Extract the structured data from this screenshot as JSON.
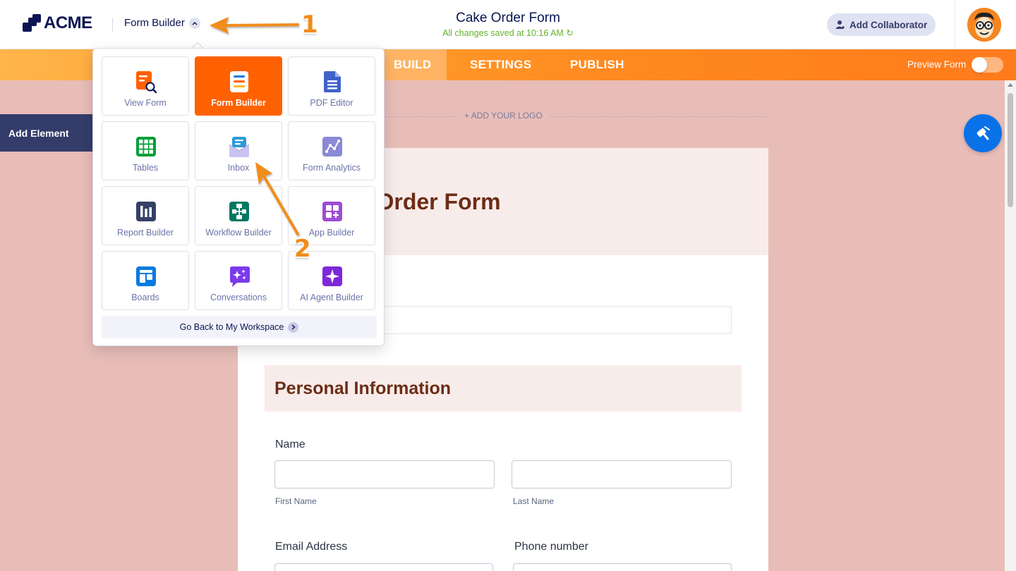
{
  "header": {
    "brand": "ACME",
    "product_switch_label": "Form Builder",
    "form_title": "Cake Order Form",
    "save_status": "All changes saved at 10:16 AM",
    "collaborator_button": "Add Collaborator"
  },
  "nav": {
    "tabs": [
      "BUILD",
      "SETTINGS",
      "PUBLISH"
    ],
    "active_tab": "BUILD",
    "preview_label": "Preview Form",
    "preview_enabled": false
  },
  "left_panel": {
    "add_element": "Add Element"
  },
  "form": {
    "add_logo": "+ ADD YOUR LOGO",
    "hero_title_visible": "ke Order Form",
    "section_title": "Personal Information",
    "fields": {
      "name_label": "Name",
      "first_name": "First Name",
      "last_name": "Last Name",
      "email_label": "Email Address",
      "phone_label": "Phone number"
    }
  },
  "dropdown": {
    "items": [
      {
        "label": "View Form",
        "icon": "view-form-icon",
        "color": "#ff6100"
      },
      {
        "label": "Form Builder",
        "icon": "form-builder-icon",
        "color": "#ff6100",
        "active": true
      },
      {
        "label": "PDF Editor",
        "icon": "pdf-editor-icon",
        "color": "#3e62c8"
      },
      {
        "label": "Tables",
        "icon": "tables-icon",
        "color": "#049e38"
      },
      {
        "label": "Inbox",
        "icon": "inbox-icon",
        "color": "#2d9ad9"
      },
      {
        "label": "Form Analytics",
        "icon": "analytics-icon",
        "color": "#8a8ad6"
      },
      {
        "label": "Report Builder",
        "icon": "report-builder-icon",
        "color": "#344067"
      },
      {
        "label": "Workflow Builder",
        "icon": "workflow-icon",
        "color": "#007862"
      },
      {
        "label": "App Builder",
        "icon": "app-builder-icon",
        "color": "#9c4dd3"
      },
      {
        "label": "Boards",
        "icon": "boards-icon",
        "color": "#0a7ae0"
      },
      {
        "label": "Conversations",
        "icon": "conversations-icon",
        "color": "#7c3aed"
      },
      {
        "label": "AI Agent Builder",
        "icon": "ai-agent-icon",
        "color": "#7d28d9"
      }
    ],
    "go_back": "Go Back to My Workspace"
  },
  "annotations": {
    "step1": "1",
    "step2": "2",
    "arrow_color": "#f28c1c"
  }
}
